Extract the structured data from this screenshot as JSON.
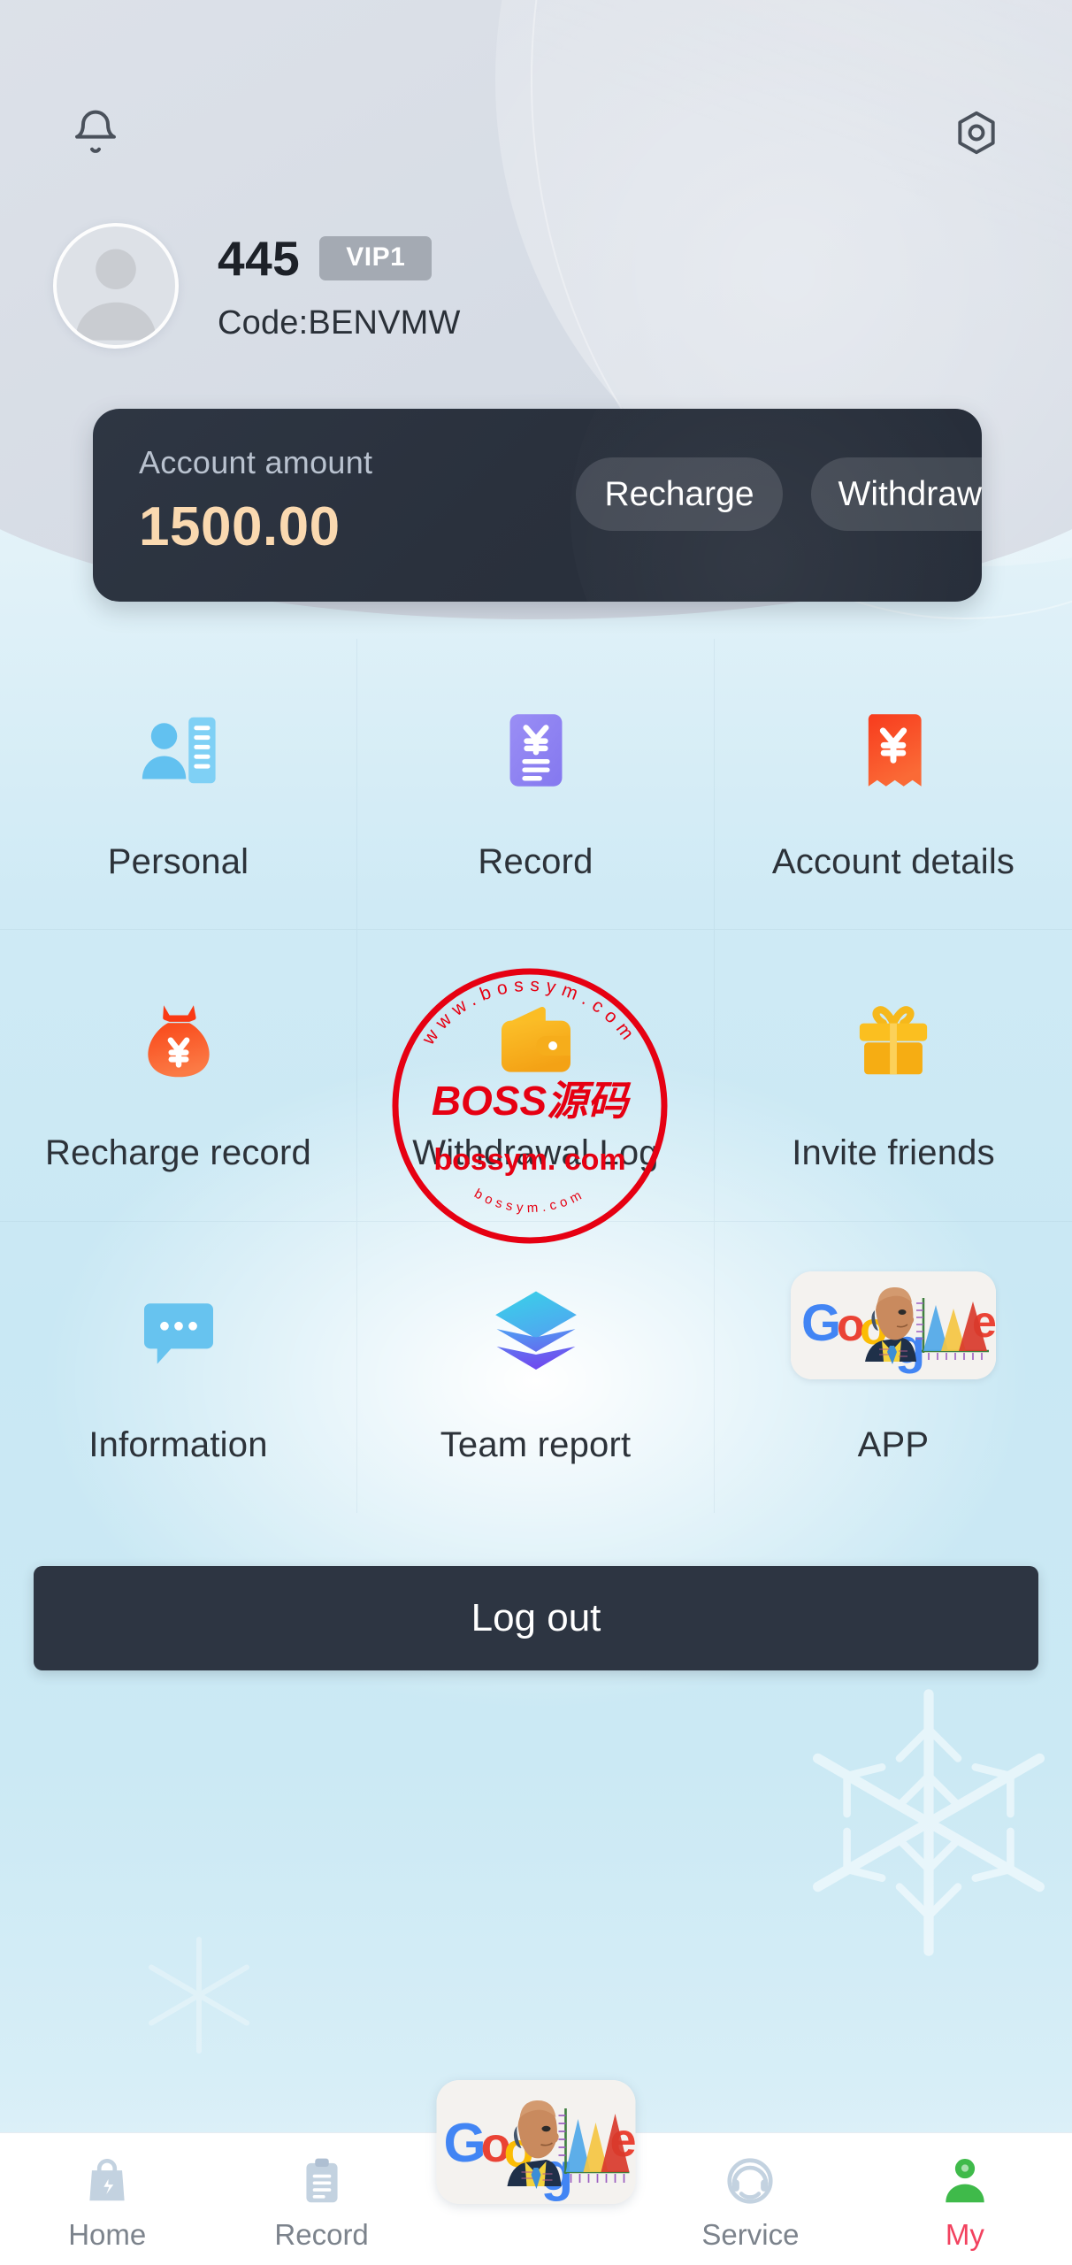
{
  "colors": {
    "header_start": "#dfe4eb",
    "header_end": "#ced5e0",
    "card_bg": "#2a313d",
    "amount_text": "#fad9b0",
    "vip_badge": "#a4aab3",
    "page_bg": "#c9e8f4",
    "logout_bg": "#2d3542",
    "active_nav": "#f2425f",
    "watermark_red": "#e60012"
  },
  "header": {
    "bell_icon": "bell-icon",
    "gear_icon": "gear-icon",
    "avatar_icon": "avatar-placeholder-icon",
    "username": "445",
    "vip_badge": "VIP1",
    "usercode": "Code:BENVMW"
  },
  "balance": {
    "label": "Account amount",
    "amount": "1500.00",
    "recharge_label": "Recharge",
    "withdraw_label": "Withdrawal"
  },
  "menu": {
    "items": [
      {
        "label": "Personal",
        "icon": "personal-card-icon"
      },
      {
        "label": "Record",
        "icon": "yen-document-icon"
      },
      {
        "label": "Account details",
        "icon": "yen-book-icon"
      },
      {
        "label": "Recharge record",
        "icon": "money-bag-icon"
      },
      {
        "label": "Withdrawal Log",
        "icon": "wallet-icon"
      },
      {
        "label": "Invite friends",
        "icon": "gift-icon"
      },
      {
        "label": "Information",
        "icon": "chat-bubble-icon"
      },
      {
        "label": "Team report",
        "icon": "layers-icon"
      },
      {
        "label": "APP",
        "icon": "google-doodle-icon"
      }
    ]
  },
  "logout": {
    "label": "Log out"
  },
  "watermark": {
    "brand": "BOSS源码",
    "domain": "bossym. com",
    "ring_top": "www.bossym.com",
    "ring_bottom": "bossym.com"
  },
  "bottom_nav": {
    "items": [
      {
        "label": "Home",
        "icon": "shopping-bag-icon",
        "active": false
      },
      {
        "label": "Record",
        "icon": "clipboard-icon",
        "active": false
      },
      {
        "label": "",
        "icon": "google-doodle-icon",
        "active": false
      },
      {
        "label": "Service",
        "icon": "headset-icon",
        "active": false
      },
      {
        "label": "My",
        "icon": "person-icon",
        "active": true
      }
    ]
  }
}
